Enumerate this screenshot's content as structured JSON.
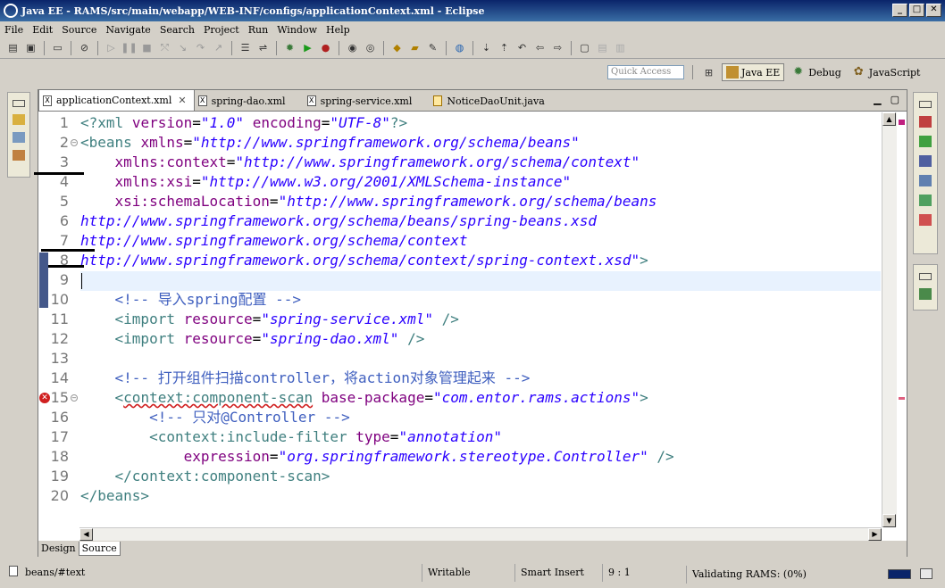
{
  "window": {
    "title": "Java EE - RAMS/src/main/webapp/WEB-INF/configs/applicationContext.xml - Eclipse",
    "minimize": "_",
    "restore": "□",
    "close": "✕"
  },
  "menu": [
    "File",
    "Edit",
    "Source",
    "Navigate",
    "Search",
    "Project",
    "Run",
    "Window",
    "Help"
  ],
  "quick_access": {
    "placeholder": "Quick Access"
  },
  "perspectives": [
    {
      "label": "Java EE",
      "icon": "javaee-icon"
    },
    {
      "label": "Debug",
      "icon": "debug-icon"
    },
    {
      "label": "JavaScript",
      "icon": "javascript-icon"
    }
  ],
  "tabs": [
    {
      "label": "applicationContext.xml",
      "active": true
    },
    {
      "label": "spring-dao.xml"
    },
    {
      "label": "spring-service.xml"
    },
    {
      "label": "NoticeDaoUnit.java"
    }
  ],
  "editor": {
    "lines": [
      {
        "n": "1",
        "html": "<span class='pi'>&lt;?xml</span> <span class='attr'>version</span>=<span class='val'>\"1.0\"</span> <span class='attr'>encoding</span>=<span class='val'>\"UTF-8\"</span><span class='pi'>?&gt;</span>"
      },
      {
        "n": "2",
        "fold": true,
        "html": "<span class='tag'>&lt;beans</span> <span class='attr'>xmlns</span>=<span class='val'>\"http://www.springframework.org/schema/beans\"</span>"
      },
      {
        "n": "3",
        "html": "    <span class='attr'>xmlns:context</span>=<span class='val'>\"http://www.springframework.org/schema/context\"</span>"
      },
      {
        "n": "4",
        "html": "    <span class='attr'>xmlns:xsi</span>=<span class='val'>\"http://www.w3.org/2001/XMLSchema-instance\"</span>"
      },
      {
        "n": "5",
        "html": "    <span class='attr'>xsi:schemaLocation</span>=<span class='val'>\"http://www.springframework.org/schema/beans</span>"
      },
      {
        "n": "6",
        "html": "<span class='val'>http://www.springframework.org/schema/beans/spring-beans.xsd</span>"
      },
      {
        "n": "7",
        "html": "<span class='val'>http://www.springframework.org/schema/context</span>"
      },
      {
        "n": "8",
        "html": "<span class='val'>http://www.springframework.org/schema/context/spring-context.xsd\"</span><span class='tag'>&gt;</span>"
      },
      {
        "n": "9",
        "html": ""
      },
      {
        "n": "10",
        "html": "    <span class='comm'>&lt;!-- 导入spring配置 --&gt;</span>"
      },
      {
        "n": "11",
        "html": "    <span class='tag'>&lt;import</span> <span class='attr'>resource</span>=<span class='val'>\"spring-service.xml\"</span> <span class='tag'>/&gt;</span>"
      },
      {
        "n": "12",
        "html": "    <span class='tag'>&lt;import</span> <span class='attr'>resource</span>=<span class='val'>\"spring-dao.xml\"</span> <span class='tag'>/&gt;</span>"
      },
      {
        "n": "13",
        "html": ""
      },
      {
        "n": "14",
        "html": "    <span class='comm'>&lt;!-- 打开组件扫描controller，将action对象管理起来 --&gt;</span>"
      },
      {
        "n": "15",
        "fold": true,
        "error": true,
        "html": "    <span class='tag'>&lt;<span class='err'>context:component-scan</span></span> <span class='attr'>base-package</span>=<span class='val'>\"com.entor.rams.actions\"</span><span class='tag'>&gt;</span>"
      },
      {
        "n": "16",
        "html": "        <span class='comm'>&lt;!-- 只对@Controller --&gt;</span>"
      },
      {
        "n": "17",
        "html": "        <span class='tag'>&lt;context:include-filter</span> <span class='attr'>type</span>=<span class='val'>\"annotation\"</span>"
      },
      {
        "n": "18",
        "html": "            <span class='attr'>expression</span>=<span class='val'>\"org.springframework.stereotype.Controller\"</span> <span class='tag'>/&gt;</span>"
      },
      {
        "n": "19",
        "html": "    <span class='tag'>&lt;/context:component-scan&gt;</span>"
      },
      {
        "n": "20",
        "html": "<span class='tag'>&lt;/beans&gt;</span>"
      }
    ]
  },
  "bottom_tabs": [
    {
      "label": "Design"
    },
    {
      "label": "Source",
      "active": true
    }
  ],
  "status": {
    "path": "beans/#text",
    "writable": "Writable",
    "insert_mode": "Smart Insert",
    "position": "9 : 1",
    "task": "Validating RAMS: (0%)"
  },
  "colors": {
    "title_bg": "#0a246a",
    "tag": "#3f7f7f",
    "attr": "#7f007f",
    "value": "#2a00ff",
    "comment": "#3f5fbf",
    "current_line": "#e8f2fe",
    "error": "#d02020"
  }
}
